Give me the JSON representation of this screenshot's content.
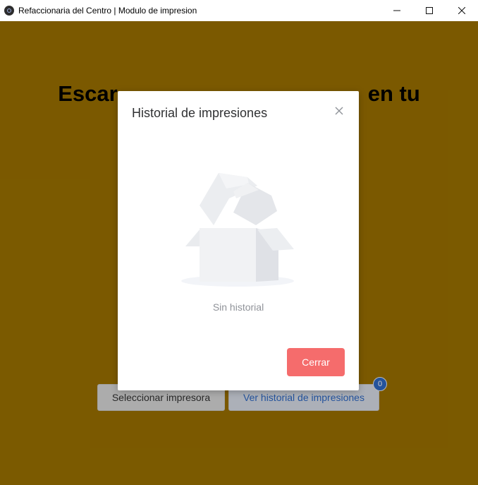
{
  "window": {
    "title": "Refaccionaria del Centro | Modulo de impresion"
  },
  "app": {
    "headline_left": "Escar",
    "headline_right": "en tu",
    "select_printer_label": "Seleccionar impresora",
    "view_history_label": "Ver historial de impresiones",
    "history_count": "0"
  },
  "modal": {
    "title": "Historial de impresiones",
    "empty_text": "Sin historial",
    "close_button_label": "Cerrar"
  },
  "colors": {
    "background": "#7a5800",
    "danger": "#f56c6c",
    "primary": "#2e68c4"
  }
}
